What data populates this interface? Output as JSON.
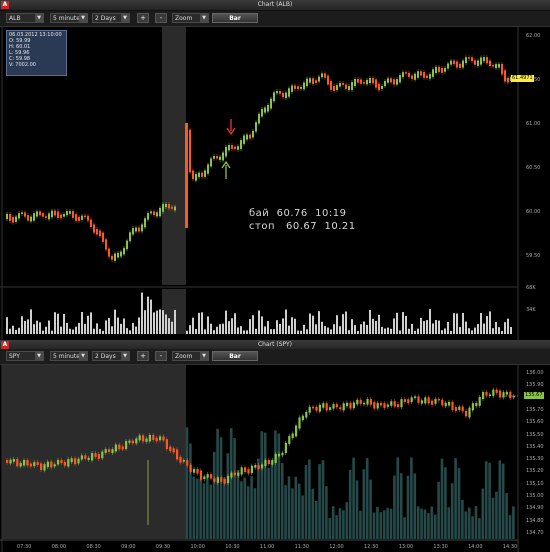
{
  "top_window": {
    "title": "Chart (ALB)",
    "toolbar": {
      "symbol": "ALB",
      "interval": "5 minutes",
      "range": "2 Days",
      "zoom_in": "+",
      "zoom_out": "-",
      "zoom_select": "Zoom",
      "bar_button": "Bar"
    },
    "ohlc": {
      "date": "06.03.2012 13:10:00",
      "open": "O: 59.99",
      "high": "H: 60.01",
      "low": "L: 59.96",
      "close": "C: 59.98",
      "volume": "V: 7002.00"
    },
    "price_axis": [
      "62.00",
      "61.50",
      "61.00",
      "60.50",
      "60.00",
      "59.50"
    ],
    "last_price": "61.4971",
    "volume_axis": [
      "68K",
      "34K"
    ],
    "annotation_line1": "бай  60.76  10:19",
    "annotation_line2": "стоп   60.67  10.21",
    "colors": {
      "up": "#8bc34a",
      "down": "#ff5722",
      "sell_arrow": "#e53935",
      "buy_arrow": "#8bc34a"
    }
  },
  "bottom_window": {
    "title": "Chart (SPY)",
    "toolbar": {
      "symbol": "SPY",
      "interval": "5 minutes",
      "range": "2 Days",
      "zoom_in": "+",
      "zoom_out": "-",
      "zoom_select": "Zoom",
      "bar_button": "Bar"
    },
    "price_axis": [
      "136.00",
      "135.90",
      "135.80",
      "135.70",
      "135.60",
      "135.50",
      "135.40",
      "135.30",
      "135.20",
      "135.10",
      "135.00",
      "134.90",
      "134.80",
      "134.70"
    ],
    "last_price": "135.67",
    "time_axis": [
      "07:30",
      "08:00",
      "08:30",
      "09:00",
      "09:30",
      "10:00",
      "10:30",
      "11:00",
      "11:30",
      "12:00",
      "12:30",
      "13:00",
      "13:30",
      "14:00",
      "14:30"
    ],
    "colors": {
      "up": "#8bc34a",
      "down": "#ff5722",
      "volume": "#264a4a"
    }
  }
}
